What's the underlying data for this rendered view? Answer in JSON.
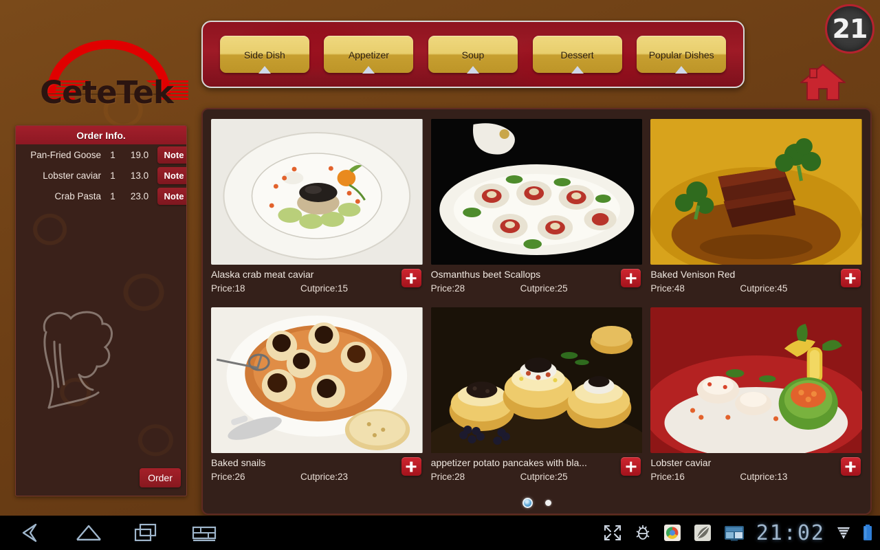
{
  "brand": {
    "name": "CeteTek",
    "logo_icon": "red-arch-logo",
    "accent": "#e00000"
  },
  "table": {
    "number": "21",
    "ring_color": "#b5222e"
  },
  "home": {
    "icon": "home-icon",
    "color": "#c8252f"
  },
  "tabs": [
    {
      "label": "Side Dish"
    },
    {
      "label": "Appetizer"
    },
    {
      "label": "Soup"
    },
    {
      "label": "Dessert"
    },
    {
      "label": "Popular Dishes"
    }
  ],
  "order_panel": {
    "title": "Order Info.",
    "note_label": "Note",
    "order_label": "Order",
    "watermark_icon": "chef-hat-icon",
    "items": [
      {
        "dish": "Pan-Fried Goose",
        "qty": "1",
        "price": "19.0"
      },
      {
        "dish": "Lobster caviar",
        "qty": "1",
        "price": "13.0"
      },
      {
        "dish": "Crab Pasta",
        "qty": "1",
        "price": "23.0"
      }
    ]
  },
  "dishes": [
    {
      "name": "Alaska crab meat caviar",
      "price": "Price:18",
      "cutprice": "Cutprice:15",
      "image": "caviar-on-white-plate"
    },
    {
      "name": "Osmanthus beet Scallops",
      "price": "Price:28",
      "cutprice": "Cutprice:25",
      "image": "scallops-platter-dark"
    },
    {
      "name": "Baked Venison Red",
      "price": "Price:48",
      "cutprice": "Cutprice:45",
      "image": "venison-with-broccoli"
    },
    {
      "name": "Baked snails",
      "price": "Price:26",
      "cutprice": "Cutprice:23",
      "image": "baked-snails-terracotta-dish"
    },
    {
      "name": "appetizer potato pancakes with bla...",
      "price": "Price:28",
      "cutprice": "Cutprice:25",
      "image": "potato-pancakes-caviar"
    },
    {
      "name": "Lobster caviar",
      "price": "Price:16",
      "cutprice": "Cutprice:13",
      "image": "lobster-caviar-plate"
    }
  ],
  "pagination": {
    "total": 2,
    "current": 1
  },
  "systembar": {
    "clock": "21:02",
    "left_icons": [
      "back-icon",
      "home-icon",
      "recents-icon",
      "keyboard-icon"
    ],
    "right_icons": [
      "fullscreen-icon",
      "usb-debug-icon",
      "browser-icon",
      "leaf-app-icon",
      "screenshot-icon",
      "wifi-icon",
      "battery-icon"
    ]
  }
}
